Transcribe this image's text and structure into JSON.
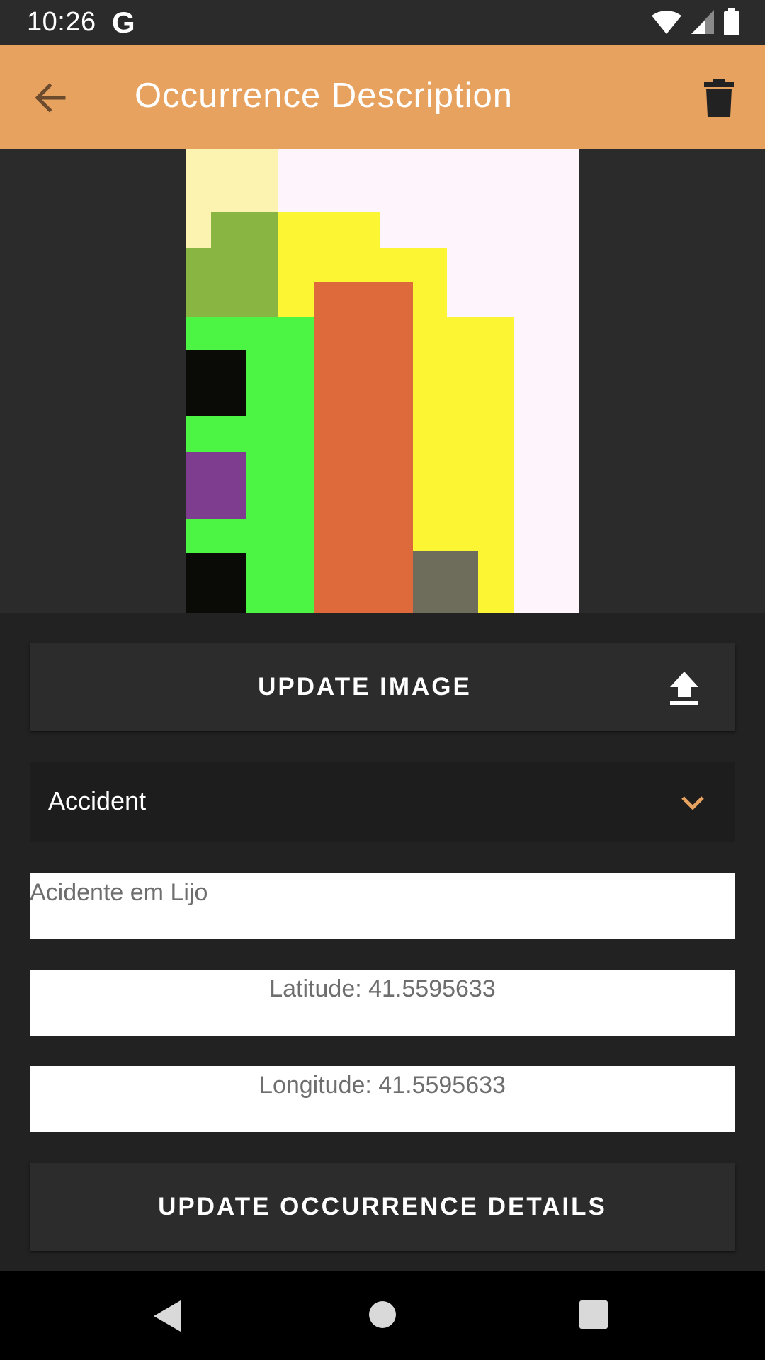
{
  "status_bar": {
    "time": "10:26",
    "g_label": "G",
    "icons": [
      "wifi-icon",
      "signal-icon",
      "battery-icon"
    ]
  },
  "app_bar": {
    "title": "Occurrence Description",
    "background": "#e8a260",
    "back_icon": "arrow-back-icon",
    "delete_icon": "trash-icon"
  },
  "image": {
    "description": "occurrence photo"
  },
  "update_image_button": {
    "label": "UPDATE IMAGE",
    "icon": "upload-icon"
  },
  "type_select": {
    "value": "Accident",
    "icon": "chevron-down-icon",
    "accent": "#e8a260"
  },
  "description_field": {
    "value": "Acidente em Lijo"
  },
  "latitude_field": {
    "value": "Latitude: 41.5595633"
  },
  "longitude_field": {
    "value": "Longitude: 41.5595633"
  },
  "update_details_button": {
    "label": "UPDATE OCCURRENCE DETAILS"
  },
  "nav_bar": {
    "back": "nav-back-icon",
    "home": "nav-home-icon",
    "recents": "nav-recents-icon"
  }
}
